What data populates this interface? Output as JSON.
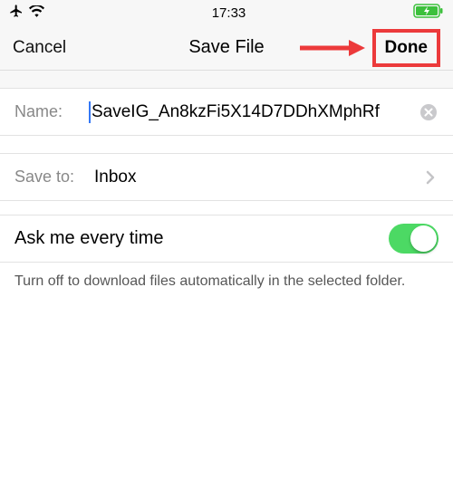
{
  "statusBar": {
    "time": "17:33"
  },
  "header": {
    "cancel": "Cancel",
    "title": "Save File",
    "done": "Done"
  },
  "nameRow": {
    "label": "Name:",
    "value": "SaveIG_An8kzFi5X14D7DDhXMphRf"
  },
  "saveToRow": {
    "label": "Save to:",
    "value": "Inbox"
  },
  "toggleRow": {
    "label": "Ask me every time",
    "on": true
  },
  "footer": {
    "text": "Turn off to download files automatically in the selected folder."
  }
}
